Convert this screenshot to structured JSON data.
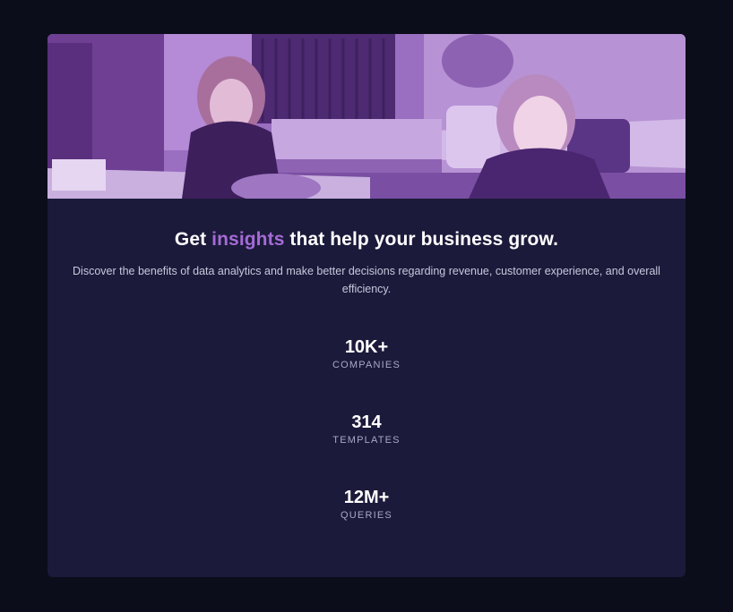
{
  "colors": {
    "page_background": "#0b0d1a",
    "card_background": "#1b1a3a",
    "accent": "#a56bd6",
    "hero_tint": "#8a5fb0"
  },
  "hero": {
    "image_description_icon": "photo-two-women-at-office"
  },
  "heading": {
    "prefix": "Get ",
    "highlight": "insights",
    "suffix": " that help your business grow."
  },
  "description": "Discover the benefits of data analytics and make better decisions regarding revenue, customer experience, and overall efficiency.",
  "stats": [
    {
      "value": "10K+",
      "label": "COMPANIES"
    },
    {
      "value": "314",
      "label": "TEMPLATES"
    },
    {
      "value": "12M+",
      "label": "QUERIES"
    }
  ]
}
